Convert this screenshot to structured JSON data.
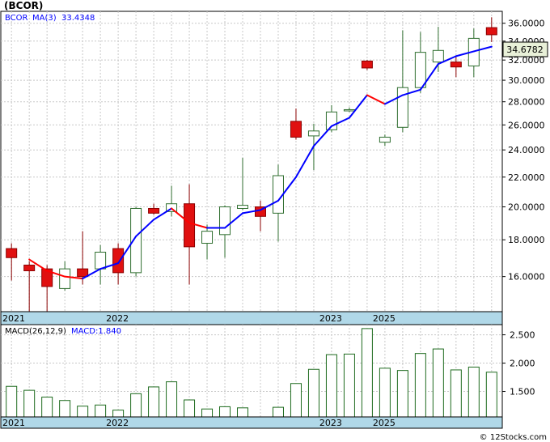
{
  "title": "(BCOR)",
  "watermark": "© 12Stocks.com",
  "colors": {
    "up_candle": "#2f6e2f",
    "down_candle": "#e01010",
    "ma_rising": "#0000ff",
    "ma_falling": "#ff0000",
    "macd_bar": "#1e6b1e",
    "axis_band": "#b0d8e8",
    "grid": "#c8c8c8",
    "last_price_box": "#e8f0d8"
  },
  "chart_data": [
    {
      "type": "candlestick",
      "name": "price",
      "legend": {
        "symbol": "BCOR",
        "ma_label": "MA(3)",
        "ma_value": "33.4348"
      },
      "last_price": "34.6782",
      "y_ticks": [
        "16.0000",
        "18.0000",
        "20.0000",
        "22.0000",
        "24.0000",
        "26.0000",
        "28.0000",
        "30.0000",
        "32.0000",
        "34.0000",
        "36.0000"
      ],
      "y_tick_values": [
        16,
        18,
        20,
        22,
        24,
        26,
        28,
        30,
        32,
        34,
        36
      ],
      "ylim": [
        14.3,
        37.4
      ],
      "scale": "log",
      "x_labels": [
        {
          "text": "2021",
          "index": 0
        },
        {
          "text": "2022",
          "index": 6
        },
        {
          "text": "2023",
          "index": 18
        },
        {
          "text": "2025",
          "index": 21
        }
      ],
      "candles": [
        {
          "o": 17.5,
          "h": 17.8,
          "l": 15.8,
          "c": 17.0
        },
        {
          "o": 16.6,
          "h": 16.8,
          "l": 14.3,
          "c": 16.3
        },
        {
          "o": 16.4,
          "h": 16.6,
          "l": 14.3,
          "c": 15.5
        },
        {
          "o": 15.4,
          "h": 16.8,
          "l": 15.3,
          "c": 16.4
        },
        {
          "o": 16.4,
          "h": 18.5,
          "l": 15.6,
          "c": 16.0
        },
        {
          "o": 16.4,
          "h": 17.7,
          "l": 15.6,
          "c": 17.3
        },
        {
          "o": 17.5,
          "h": 17.8,
          "l": 15.6,
          "c": 16.2
        },
        {
          "o": 16.2,
          "h": 20.0,
          "l": 16.0,
          "c": 19.9
        },
        {
          "o": 19.9,
          "h": 20.2,
          "l": 19.5,
          "c": 19.6
        },
        {
          "o": 19.7,
          "h": 21.4,
          "l": 19.4,
          "c": 20.2
        },
        {
          "o": 20.2,
          "h": 21.5,
          "l": 15.6,
          "c": 17.6
        },
        {
          "o": 17.8,
          "h": 18.9,
          "l": 16.9,
          "c": 18.5
        },
        {
          "o": 18.3,
          "h": 20.1,
          "l": 17.0,
          "c": 20.0
        },
        {
          "o": 19.9,
          "h": 23.4,
          "l": 19.8,
          "c": 20.1
        },
        {
          "o": 20.0,
          "h": 20.4,
          "l": 18.5,
          "c": 19.4
        },
        {
          "o": 19.6,
          "h": 22.9,
          "l": 17.9,
          "c": 22.1
        },
        {
          "o": 26.3,
          "h": 27.4,
          "l": 24.8,
          "c": 25.0
        },
        {
          "o": 25.1,
          "h": 26.1,
          "l": 22.5,
          "c": 25.5
        },
        {
          "o": 25.6,
          "h": 27.7,
          "l": 25.4,
          "c": 27.1
        },
        {
          "o": 27.3,
          "h": 27.5,
          "l": 27.1,
          "c": 27.3
        },
        {
          "o": 31.9,
          "h": 32.0,
          "l": 31.0,
          "c": 31.2
        },
        {
          "o": 24.6,
          "h": 25.2,
          "l": 24.3,
          "c": 25.0
        },
        {
          "o": 25.8,
          "h": 35.2,
          "l": 25.4,
          "c": 29.3
        },
        {
          "o": 29.3,
          "h": 35.0,
          "l": 28.8,
          "c": 32.8
        },
        {
          "o": 31.8,
          "h": 35.6,
          "l": 30.8,
          "c": 33.0
        },
        {
          "o": 31.8,
          "h": 32.3,
          "l": 30.3,
          "c": 31.3
        },
        {
          "o": 31.4,
          "h": 35.4,
          "l": 30.3,
          "c": 34.3
        },
        {
          "o": 35.5,
          "h": 36.7,
          "l": 33.9,
          "c": 34.7
        }
      ],
      "ma_series": {
        "name": "MA(3)",
        "start_index": 1,
        "values": [
          16.9,
          16.3,
          16.0,
          15.9,
          16.4,
          16.7,
          18.2,
          19.2,
          19.9,
          19.0,
          18.7,
          18.7,
          19.6,
          19.8,
          20.4,
          22.0,
          24.3,
          25.9,
          26.6,
          28.6,
          27.8,
          28.6,
          29.1,
          31.6,
          32.4,
          32.9,
          33.4
        ]
      }
    },
    {
      "type": "bar",
      "name": "MACD",
      "legend": {
        "params_label": "MACD(26,12,9)",
        "value_label": "MACD:1.840"
      },
      "y_ticks": [
        "1.500",
        "2.000",
        "2.500"
      ],
      "y_tick_values": [
        1.5,
        2.0,
        2.5
      ],
      "ylim": [
        1.05,
        2.68
      ],
      "x_labels": [
        {
          "text": "2021",
          "index": 0
        },
        {
          "text": "2022",
          "index": 6
        },
        {
          "text": "2023",
          "index": 18
        },
        {
          "text": "2025",
          "index": 21
        }
      ],
      "values": [
        1.59,
        1.52,
        1.4,
        1.34,
        1.24,
        1.26,
        1.17,
        1.46,
        1.58,
        1.67,
        1.35,
        1.19,
        1.23,
        1.21,
        null,
        1.22,
        1.64,
        1.89,
        2.15,
        2.16,
        2.61,
        1.91,
        1.87,
        2.17,
        2.25,
        1.88,
        1.93,
        1.84
      ]
    }
  ]
}
